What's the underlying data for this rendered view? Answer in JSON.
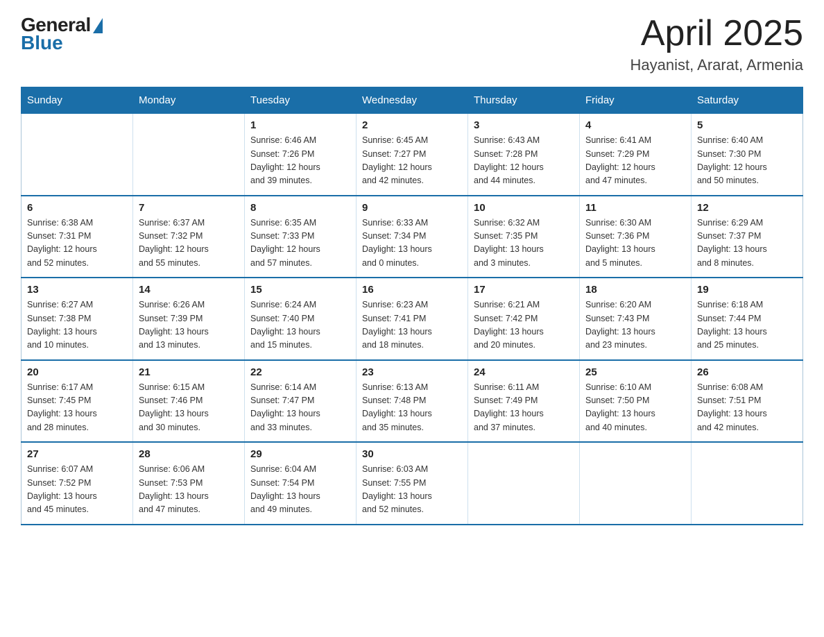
{
  "logo": {
    "general": "General",
    "blue": "Blue"
  },
  "header": {
    "title": "April 2025",
    "location": "Hayanist, Ararat, Armenia"
  },
  "days_of_week": [
    "Sunday",
    "Monday",
    "Tuesday",
    "Wednesday",
    "Thursday",
    "Friday",
    "Saturday"
  ],
  "weeks": [
    [
      {
        "day": "",
        "info": ""
      },
      {
        "day": "",
        "info": ""
      },
      {
        "day": "1",
        "info": "Sunrise: 6:46 AM\nSunset: 7:26 PM\nDaylight: 12 hours\nand 39 minutes."
      },
      {
        "day": "2",
        "info": "Sunrise: 6:45 AM\nSunset: 7:27 PM\nDaylight: 12 hours\nand 42 minutes."
      },
      {
        "day": "3",
        "info": "Sunrise: 6:43 AM\nSunset: 7:28 PM\nDaylight: 12 hours\nand 44 minutes."
      },
      {
        "day": "4",
        "info": "Sunrise: 6:41 AM\nSunset: 7:29 PM\nDaylight: 12 hours\nand 47 minutes."
      },
      {
        "day": "5",
        "info": "Sunrise: 6:40 AM\nSunset: 7:30 PM\nDaylight: 12 hours\nand 50 minutes."
      }
    ],
    [
      {
        "day": "6",
        "info": "Sunrise: 6:38 AM\nSunset: 7:31 PM\nDaylight: 12 hours\nand 52 minutes."
      },
      {
        "day": "7",
        "info": "Sunrise: 6:37 AM\nSunset: 7:32 PM\nDaylight: 12 hours\nand 55 minutes."
      },
      {
        "day": "8",
        "info": "Sunrise: 6:35 AM\nSunset: 7:33 PM\nDaylight: 12 hours\nand 57 minutes."
      },
      {
        "day": "9",
        "info": "Sunrise: 6:33 AM\nSunset: 7:34 PM\nDaylight: 13 hours\nand 0 minutes."
      },
      {
        "day": "10",
        "info": "Sunrise: 6:32 AM\nSunset: 7:35 PM\nDaylight: 13 hours\nand 3 minutes."
      },
      {
        "day": "11",
        "info": "Sunrise: 6:30 AM\nSunset: 7:36 PM\nDaylight: 13 hours\nand 5 minutes."
      },
      {
        "day": "12",
        "info": "Sunrise: 6:29 AM\nSunset: 7:37 PM\nDaylight: 13 hours\nand 8 minutes."
      }
    ],
    [
      {
        "day": "13",
        "info": "Sunrise: 6:27 AM\nSunset: 7:38 PM\nDaylight: 13 hours\nand 10 minutes."
      },
      {
        "day": "14",
        "info": "Sunrise: 6:26 AM\nSunset: 7:39 PM\nDaylight: 13 hours\nand 13 minutes."
      },
      {
        "day": "15",
        "info": "Sunrise: 6:24 AM\nSunset: 7:40 PM\nDaylight: 13 hours\nand 15 minutes."
      },
      {
        "day": "16",
        "info": "Sunrise: 6:23 AM\nSunset: 7:41 PM\nDaylight: 13 hours\nand 18 minutes."
      },
      {
        "day": "17",
        "info": "Sunrise: 6:21 AM\nSunset: 7:42 PM\nDaylight: 13 hours\nand 20 minutes."
      },
      {
        "day": "18",
        "info": "Sunrise: 6:20 AM\nSunset: 7:43 PM\nDaylight: 13 hours\nand 23 minutes."
      },
      {
        "day": "19",
        "info": "Sunrise: 6:18 AM\nSunset: 7:44 PM\nDaylight: 13 hours\nand 25 minutes."
      }
    ],
    [
      {
        "day": "20",
        "info": "Sunrise: 6:17 AM\nSunset: 7:45 PM\nDaylight: 13 hours\nand 28 minutes."
      },
      {
        "day": "21",
        "info": "Sunrise: 6:15 AM\nSunset: 7:46 PM\nDaylight: 13 hours\nand 30 minutes."
      },
      {
        "day": "22",
        "info": "Sunrise: 6:14 AM\nSunset: 7:47 PM\nDaylight: 13 hours\nand 33 minutes."
      },
      {
        "day": "23",
        "info": "Sunrise: 6:13 AM\nSunset: 7:48 PM\nDaylight: 13 hours\nand 35 minutes."
      },
      {
        "day": "24",
        "info": "Sunrise: 6:11 AM\nSunset: 7:49 PM\nDaylight: 13 hours\nand 37 minutes."
      },
      {
        "day": "25",
        "info": "Sunrise: 6:10 AM\nSunset: 7:50 PM\nDaylight: 13 hours\nand 40 minutes."
      },
      {
        "day": "26",
        "info": "Sunrise: 6:08 AM\nSunset: 7:51 PM\nDaylight: 13 hours\nand 42 minutes."
      }
    ],
    [
      {
        "day": "27",
        "info": "Sunrise: 6:07 AM\nSunset: 7:52 PM\nDaylight: 13 hours\nand 45 minutes."
      },
      {
        "day": "28",
        "info": "Sunrise: 6:06 AM\nSunset: 7:53 PM\nDaylight: 13 hours\nand 47 minutes."
      },
      {
        "day": "29",
        "info": "Sunrise: 6:04 AM\nSunset: 7:54 PM\nDaylight: 13 hours\nand 49 minutes."
      },
      {
        "day": "30",
        "info": "Sunrise: 6:03 AM\nSunset: 7:55 PM\nDaylight: 13 hours\nand 52 minutes."
      },
      {
        "day": "",
        "info": ""
      },
      {
        "day": "",
        "info": ""
      },
      {
        "day": "",
        "info": ""
      }
    ]
  ]
}
